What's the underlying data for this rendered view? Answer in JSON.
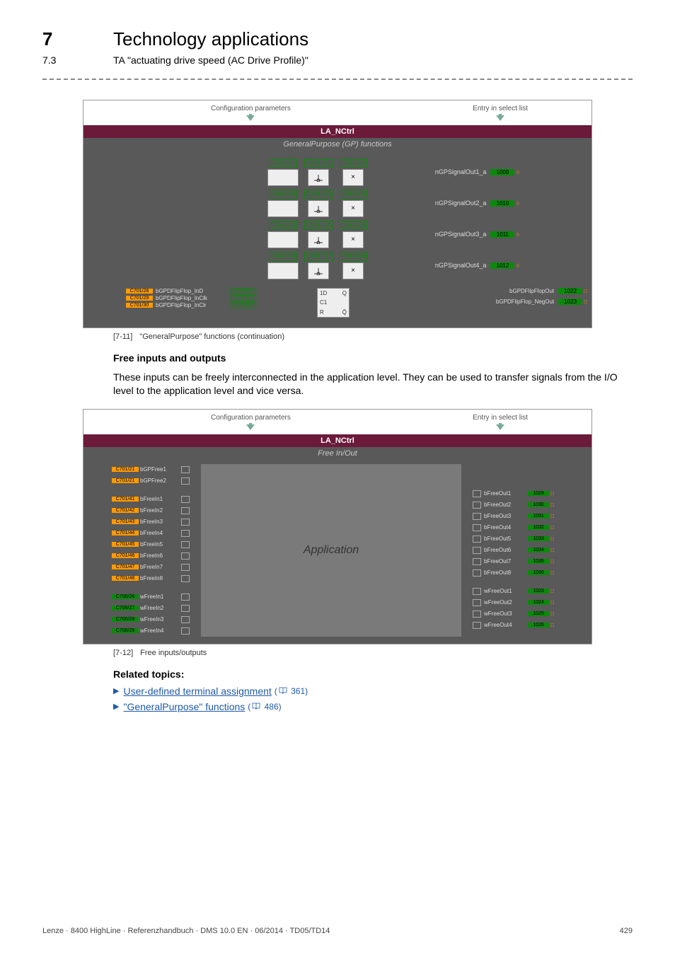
{
  "header": {
    "chapter_num": "7",
    "chapter_title": "Technology applications",
    "section_num": "7.3",
    "section_title": "TA \"actuating drive speed (AC Drive Profile)\""
  },
  "fig1": {
    "cfg_label": "Configuration parameters",
    "entry_label": "Entry in select list",
    "la": "LA_NCtrl",
    "section": "GeneralPurpose (GP) functions",
    "rows": [
      {
        "c_a": "C00410/1",
        "c_b": "C00413/1",
        "c_c": "C00413/2",
        "sig": "nGPSignalOut1_a",
        "pill": "1009"
      },
      {
        "c_a": "C00410/2",
        "c_b": "C00413/3",
        "c_c": "C00413/4",
        "sig": "nGPSignalOut2_a",
        "pill": "1010"
      },
      {
        "c_a": "C00410/3",
        "c_b": "C00413/5",
        "c_c": "C00413/6",
        "sig": "nGPSignalOut3_a",
        "pill": "1011"
      },
      {
        "c_a": "C00410/4",
        "c_b": "C00413/7",
        "c_c": "C00413/8",
        "sig": "nGPSignalOut4_a",
        "pill": "1012"
      }
    ],
    "ff_in": [
      {
        "port": "C701/28",
        "name": "bGPDFlipFlop_InD",
        "c": "C00833/4"
      },
      {
        "port": "C701/29",
        "name": "bGPDFlipFlop_InClk",
        "c": "C00833/5"
      },
      {
        "port": "C701/30",
        "name": "bGPDFlipFlop_InClr",
        "c": "C00833/6"
      }
    ],
    "ff_box": {
      "tl": "1D",
      "tr": "Q",
      "ml": "C1",
      "bl": "R",
      "br": "Q̄"
    },
    "ff_out": [
      {
        "lab": "bGPDFlipFlopOut",
        "pill": "1022"
      },
      {
        "lab": "bGPDFlipFlop_NegOut",
        "pill": "1023"
      }
    ]
  },
  "cap1": {
    "num": "[7-11]",
    "text": "\"GeneralPurpose\" functions (continuation)"
  },
  "free_h": "Free inputs and outputs",
  "free_p": "These inputs can be freely interconnected in the application level. They can be used to transfer signals from the I/O level to the application level and vice versa.",
  "fig2": {
    "cfg_label": "Configuration parameters",
    "entry_label": "Entry in select list",
    "la": "LA_NCtrl",
    "section": "Free In/Out",
    "mid": "Application",
    "gp": [
      {
        "port": "C701/21",
        "name": "bGPFree1"
      },
      {
        "port": "C701/21",
        "name": "bGPFree2"
      }
    ],
    "bIn": [
      {
        "port": "C701/41",
        "name": "bFreeIn1"
      },
      {
        "port": "C701/42",
        "name": "bFreeIn2"
      },
      {
        "port": "C701/43",
        "name": "bFreeIn3"
      },
      {
        "port": "C701/44",
        "name": "bFreeIn4"
      },
      {
        "port": "C701/45",
        "name": "bFreeIn5"
      },
      {
        "port": "C701/46",
        "name": "bFreeIn6"
      },
      {
        "port": "C701/47",
        "name": "bFreeIn7"
      },
      {
        "port": "C701/48",
        "name": "bFreeIn8"
      }
    ],
    "wIn": [
      {
        "port": "C700/26",
        "name": "wFreeIn1"
      },
      {
        "port": "C700/27",
        "name": "wFreeIn2"
      },
      {
        "port": "C700/28",
        "name": "wFreeIn3"
      },
      {
        "port": "C700/29",
        "name": "wFreeIn4"
      }
    ],
    "bOut": [
      {
        "name": "bFreeOut1",
        "pill": "1029"
      },
      {
        "name": "bFreeOut2",
        "pill": "1030"
      },
      {
        "name": "bFreeOut3",
        "pill": "1031"
      },
      {
        "name": "bFreeOut4",
        "pill": "1032"
      },
      {
        "name": "bFreeOut5",
        "pill": "1033"
      },
      {
        "name": "bFreeOut6",
        "pill": "1034"
      },
      {
        "name": "bFreeOut7",
        "pill": "1035"
      },
      {
        "name": "bFreeOut8",
        "pill": "1036"
      }
    ],
    "wOut": [
      {
        "name": "wFreeOut1",
        "pill": "1023"
      },
      {
        "name": "wFreeOut2",
        "pill": "1024"
      },
      {
        "name": "wFreeOut3",
        "pill": "1025"
      },
      {
        "name": "wFreeOut4",
        "pill": "1026"
      }
    ]
  },
  "cap2": {
    "num": "[7-12]",
    "text": "Free inputs/outputs"
  },
  "topics": {
    "title": "Related topics:",
    "items": [
      {
        "text": "User-defined terminal assignment",
        "page": "361"
      },
      {
        "text": "\"GeneralPurpose\" functions",
        "page": "486"
      }
    ]
  },
  "footer": {
    "left": "Lenze · 8400 HighLine · Referenzhandbuch · DMS 10.0 EN · 06/2014 · TD05/TD14",
    "right": "429"
  }
}
